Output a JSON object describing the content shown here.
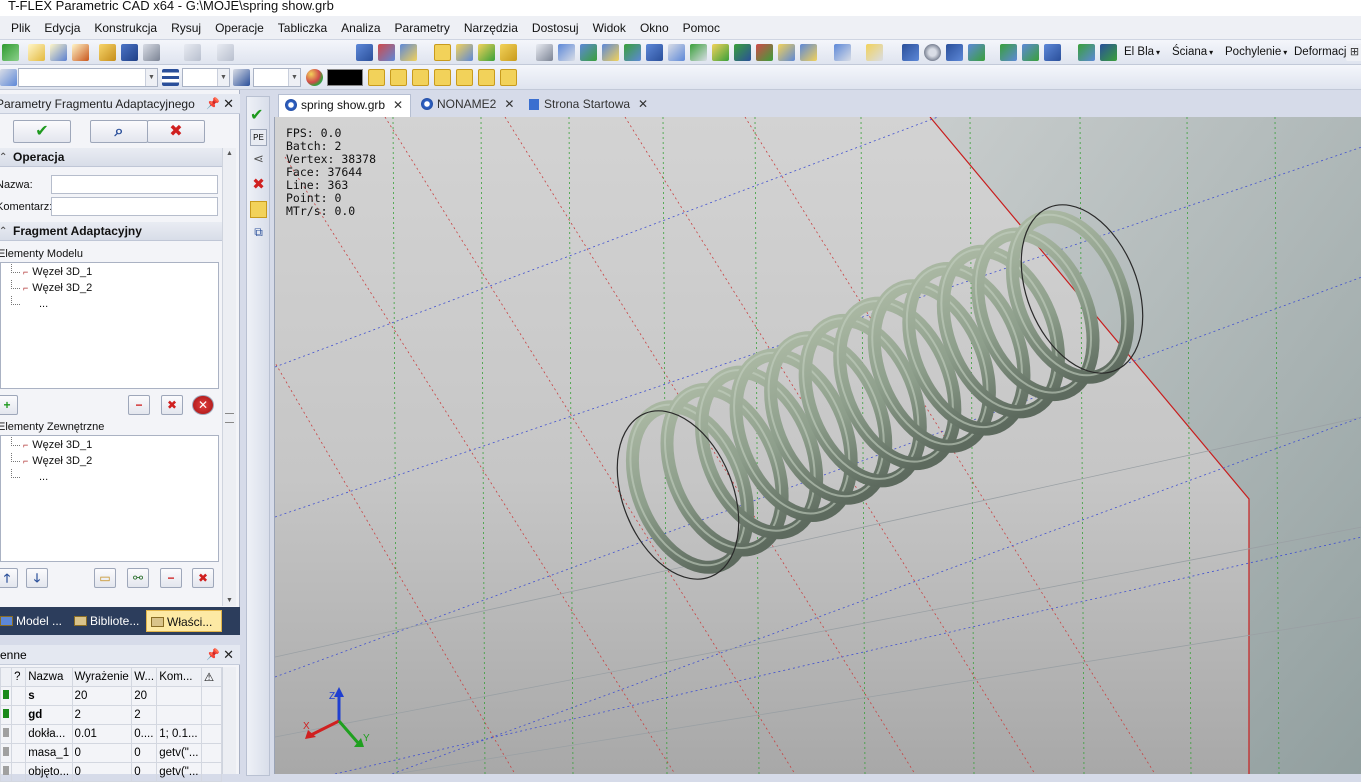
{
  "app": {
    "title": "T-FLEX Parametric CAD x64 - G:\\MOJE\\spring show.grb"
  },
  "menu": [
    "Plik",
    "Edycja",
    "Konstrukcja",
    "Rysuj",
    "Operacje",
    "Tabliczka",
    "Analiza",
    "Parametry",
    "Narzędzia",
    "Dostosuj",
    "Widok",
    "Okno",
    "Pomoc"
  ],
  "toolbar": {
    "dropdowns": [
      "El Bla",
      "Ściana",
      "Pochylenie",
      "Deformacja"
    ],
    "color_swatch": "#000000",
    "accent": "#f2d25a"
  },
  "panel": {
    "title": "Parametry Fragmentu Adaptacyjnego",
    "buttons": {
      "ok": "✔",
      "preview": "⌕",
      "cancel": "✖"
    },
    "section_operation": "Operacja",
    "name_label": "Nazwa:",
    "comment_label": "Komentarz:",
    "name_value": "",
    "comment_value": "",
    "section_fragment": "Fragment Adaptacyjny",
    "model_elements_label": "Elementy Modelu",
    "model_elements": [
      "Węzeł 3D_1",
      "Węzeł 3D_2",
      "..."
    ],
    "external_elements_label": "Elementy Zewnętrzne",
    "external_elements": [
      "Węzeł 3D_1",
      "Węzeł 3D_2",
      "..."
    ],
    "tabs": [
      {
        "label": "Model ...",
        "active": false
      },
      {
        "label": "Bibliote...",
        "active": false
      },
      {
        "label": "Właści...",
        "active": true
      }
    ]
  },
  "variables": {
    "title": "Zmienne",
    "columns": [
      "?",
      "Nazwa",
      "Wyrażenie",
      "W...",
      "Kom..."
    ],
    "rows": [
      {
        "name": "s",
        "expr": "20",
        "value": "20",
        "comment": "",
        "bold": true
      },
      {
        "name": "gd",
        "expr": "2",
        "value": "2",
        "comment": "",
        "bold": true
      },
      {
        "name": "dokła...",
        "expr": "0.01",
        "value": "0....",
        "comment": "1; 0.1...",
        "bold": false
      },
      {
        "name": "masa_1",
        "expr": "0",
        "value": "0",
        "comment": "getv(\"...",
        "bold": false
      },
      {
        "name": "objęto...",
        "expr": "0",
        "value": "0",
        "comment": "getv(\"...",
        "bold": false
      }
    ]
  },
  "doc_tabs": [
    {
      "label": "spring show.grb",
      "active": true
    },
    {
      "label": "NONAME2",
      "active": false
    },
    {
      "label": "Strona Startowa",
      "active": false
    }
  ],
  "viewport": {
    "stats": {
      "fps": "FPS: 0.0",
      "batch": "Batch: 2",
      "vertex": "Vertex: 38378",
      "face": "Face: 37644",
      "line": "Line: 363",
      "point": "Point: 0",
      "mtrs": "MTr/s: 0.0"
    },
    "axes": {
      "x": "X",
      "y": "Y",
      "z": "Z"
    },
    "coil_count": 12,
    "spring_color": "#8d9e8b"
  }
}
